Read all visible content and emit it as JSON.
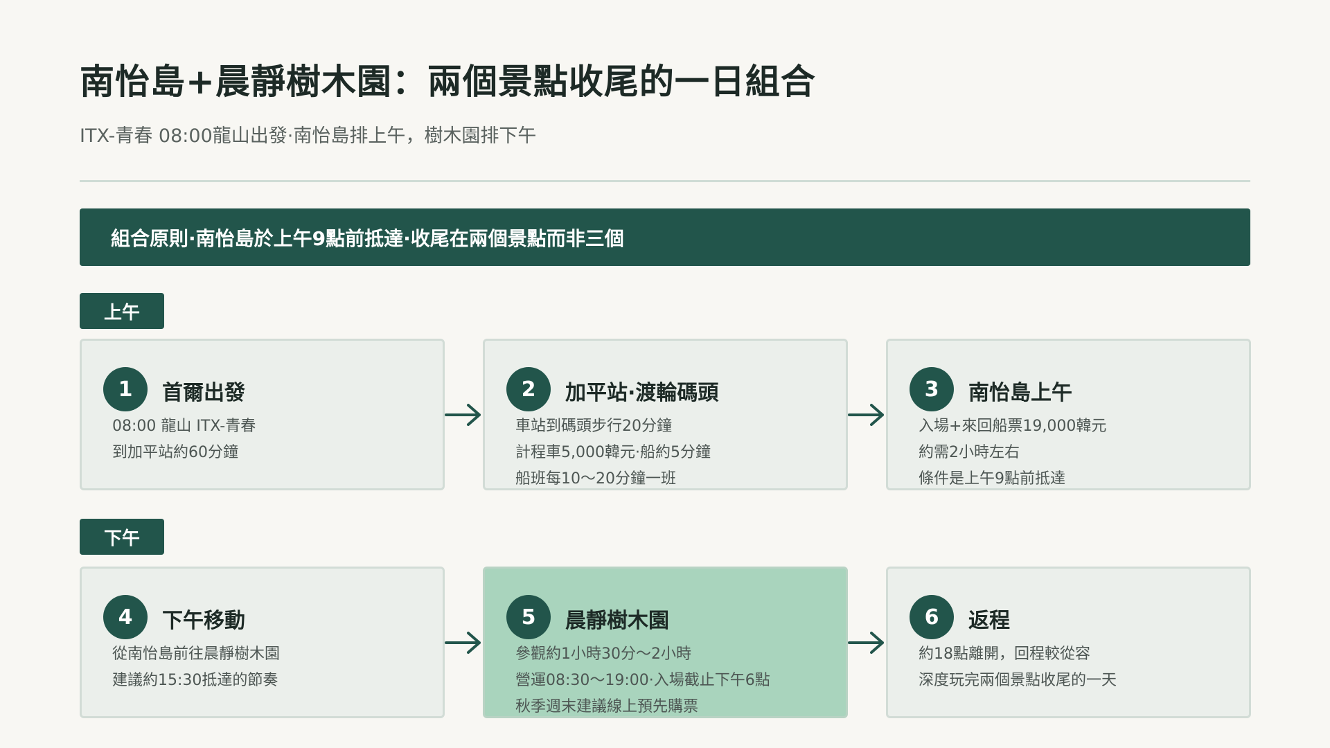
{
  "header": {
    "title": "南怡島+晨靜樹木園：兩個景點收尾的一日組合",
    "subtitle": "ITX-青春 08:00龍山出發·南怡島排上午，樹木園排下午"
  },
  "banner": {
    "text": "組合原則·南怡島於上午9點前抵達·收尾在兩個景點而非三個"
  },
  "sections": {
    "morning": {
      "label": "上午",
      "cards": [
        {
          "number": "1",
          "title": "首爾出發",
          "lines": [
            "08:00 龍山 ITX-青春",
            "到加平站約60分鐘"
          ]
        },
        {
          "number": "2",
          "title": "加平站·渡輪碼頭",
          "lines": [
            "車站到碼頭步行20分鐘",
            "計程車5,000韓元·船約5分鐘",
            "船班每10～20分鐘一班"
          ]
        },
        {
          "number": "3",
          "title": "南怡島上午",
          "lines": [
            "入場+來回船票19,000韓元",
            "約需2小時左右",
            "條件是上午9點前抵達"
          ]
        }
      ]
    },
    "afternoon": {
      "label": "下午",
      "cards": [
        {
          "number": "4",
          "title": "下午移動",
          "lines": [
            "從南怡島前往晨靜樹木園",
            "建議約15:30抵達的節奏"
          ]
        },
        {
          "number": "5",
          "title": "晨靜樹木園",
          "lines": [
            "參觀約1小時30分～2小時",
            "營運08:30～19:00·入場截止下午6點",
            "秋季週末建議線上預先購票"
          ]
        },
        {
          "number": "6",
          "title": "返程",
          "lines": [
            "約18點離開，回程較從容",
            "深度玩完兩個景點收尾的一天"
          ]
        }
      ]
    }
  },
  "colors": {
    "accent": "#22554b",
    "background": "#f8f7f3",
    "card": "#ebefeb",
    "highlight_card": "#a9d4bd"
  }
}
